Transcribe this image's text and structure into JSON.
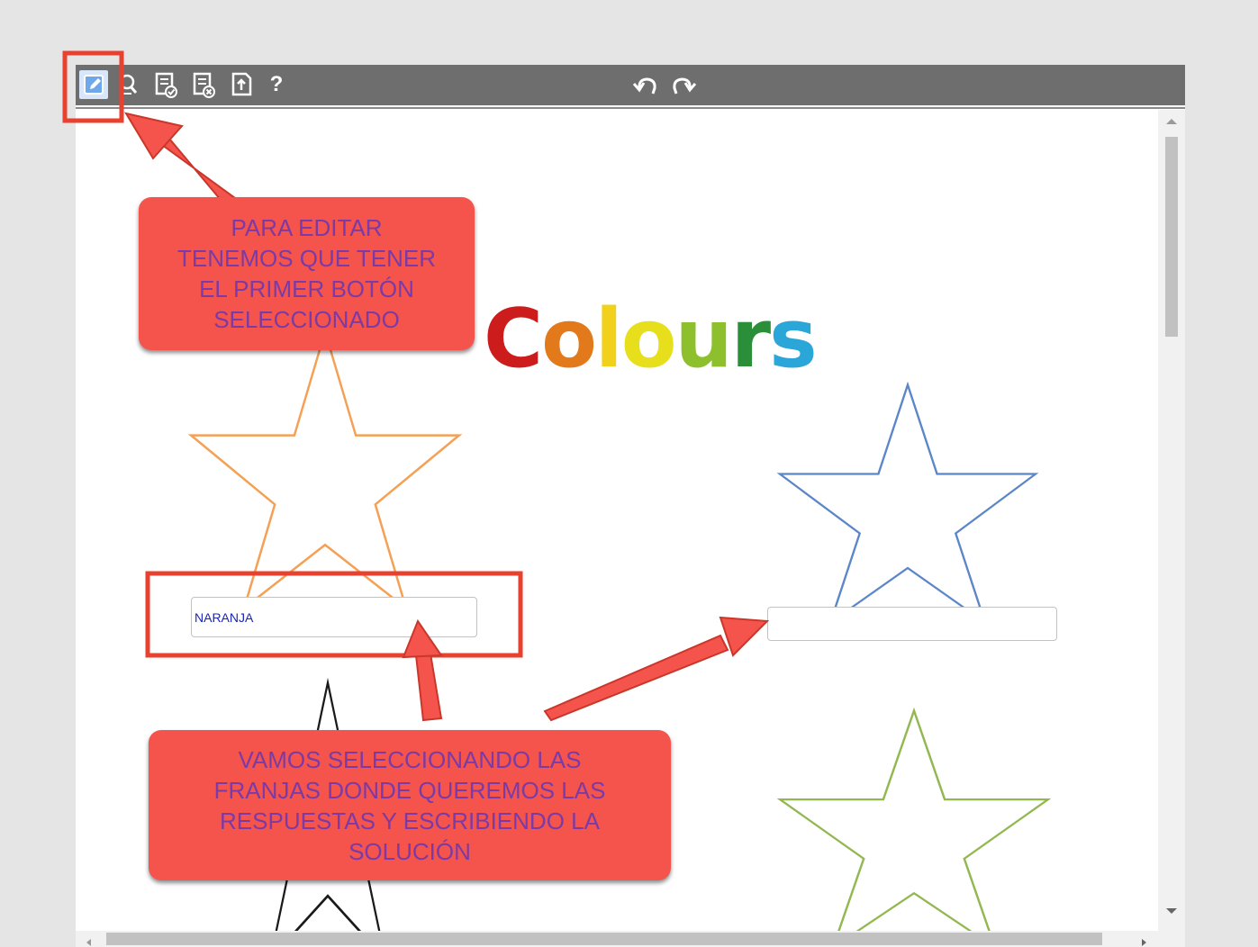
{
  "toolbar": {
    "tools": [
      {
        "name": "edit-icon",
        "active": true
      },
      {
        "name": "preview-icon"
      },
      {
        "name": "check-document-icon"
      },
      {
        "name": "clear-document-icon"
      },
      {
        "name": "export-icon"
      },
      {
        "name": "help-icon",
        "label": "?"
      }
    ],
    "history": [
      "undo-icon",
      "redo-icon"
    ],
    "colors": {
      "background": "#6e6e6e",
      "active_tool": "#d7e6fa"
    }
  },
  "worksheet": {
    "title": {
      "letters": [
        "C",
        "o",
        "l",
        "o",
        "u",
        "r",
        "s"
      ],
      "colors": [
        "#cc1c1c",
        "#e27a1c",
        "#f2d11c",
        "#e8df1c",
        "#8ebf2d",
        "#2b8f3a",
        "#2aa7d8"
      ]
    },
    "stars": [
      {
        "name": "orange-star",
        "color": "#f4a055"
      },
      {
        "name": "blue-star",
        "color": "#5b86c7"
      },
      {
        "name": "black-star",
        "color": "#1a1a1a"
      },
      {
        "name": "green-star",
        "color": "#93b851"
      }
    ],
    "answers": [
      {
        "name": "answer-orange",
        "value": "NARANJA"
      },
      {
        "name": "answer-blue",
        "value": ""
      }
    ]
  },
  "annotations": {
    "callout_top": [
      "PARA EDITAR",
      "TENEMOS QUE TENER",
      "EL PRIMER BOTÓN",
      "SELECCIONADO"
    ],
    "callout_bottom": [
      "VAMOS SELECCIONANDO LAS",
      "FRANJAS DONDE QUEREMOS LAS",
      "RESPUESTAS Y ESCRIBIENDO LA",
      "SOLUCIÓN"
    ],
    "colors": {
      "callout_fill": "#f5544c",
      "callout_text": "#7b3aa6",
      "highlight": "#e8412f"
    }
  }
}
